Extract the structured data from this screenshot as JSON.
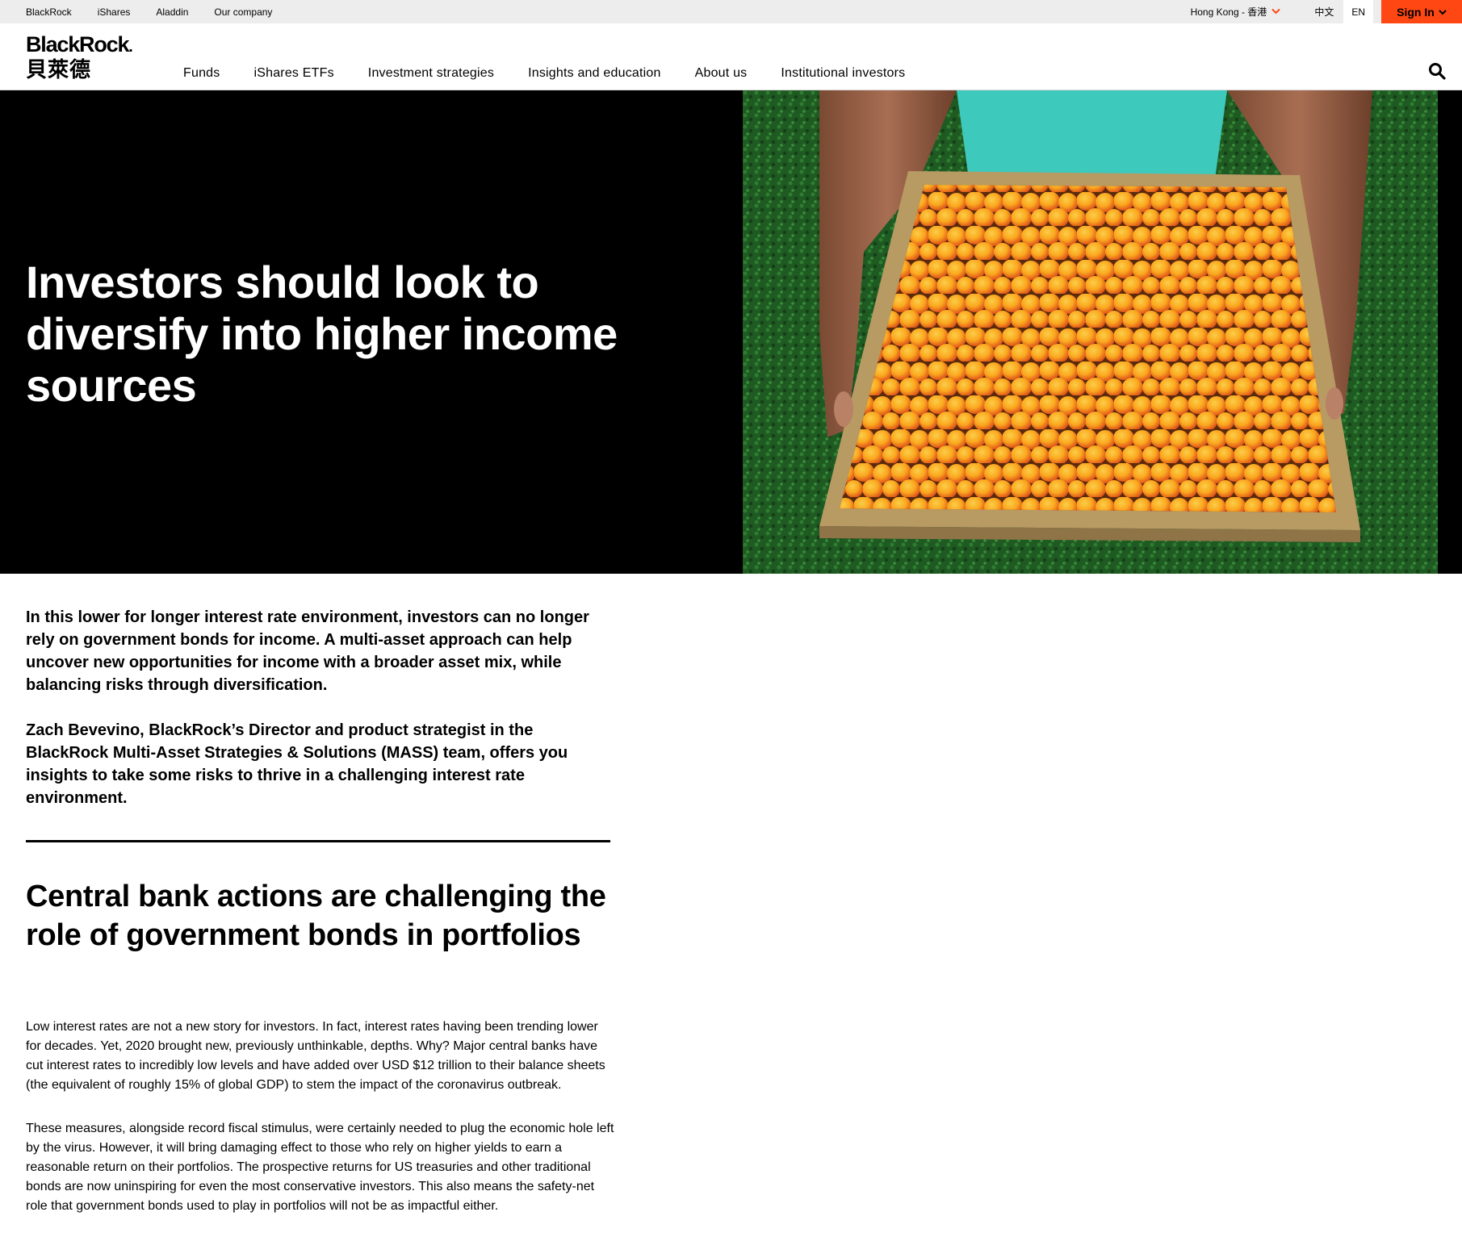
{
  "utility": {
    "links": [
      "BlackRock",
      "iShares",
      "Aladdin",
      "Our company"
    ],
    "region": "Hong Kong - 香港",
    "lang_zh": "中文",
    "lang_en": "EN",
    "signin": "Sign In"
  },
  "header": {
    "logo_en": "BlackRock",
    "logo_dot": ".",
    "logo_zh": "貝萊德",
    "nav": [
      "Funds",
      "iShares ETFs",
      "Investment strategies",
      "Insights and education",
      "About us",
      "Institutional investors"
    ]
  },
  "hero": {
    "title": "Investors should look to diversify into higher income sources"
  },
  "article": {
    "intro_1": "In this lower for longer interest rate environment, investors can no longer rely on government bonds for income.  A multi-asset approach can help uncover new opportunities for income with a broader asset mix, while balancing risks through diversification.",
    "intro_2": "Zach Bevevino, BlackRock’s Director and product strategist in the BlackRock Multi-Asset Strategies & Solutions (MASS) team, offers you insights to take some risks to thrive in a challenging interest rate environment.",
    "heading": "Central bank actions are challenging the role of government bonds in portfolios",
    "para_1": "Low interest rates are not a new story for investors. In fact, interest rates having been trending lower for decades. Yet, 2020 brought new, previously unthinkable, depths. Why? Major central banks have cut interest rates to incredibly low levels and have added over USD $12 trillion to their balance sheets (the equivalent of roughly 15% of global GDP) to stem the impact of the coronavirus outbreak.",
    "para_2": "These measures, alongside record fiscal stimulus, were certainly needed to plug the economic hole left by the virus. However, it will bring  damaging effect  to those who rely on higher yields to earn a reasonable return on their portfolios. The prospective returns for US treasuries and other traditional bonds are now uninspiring for even the most conservative investors. This also means the safety-net role that government bonds used to play in portfolios will not be as impactful either."
  },
  "colors": {
    "accent": "#ff4713",
    "hero_bg": "#000000",
    "utility_bg": "#ededed"
  }
}
